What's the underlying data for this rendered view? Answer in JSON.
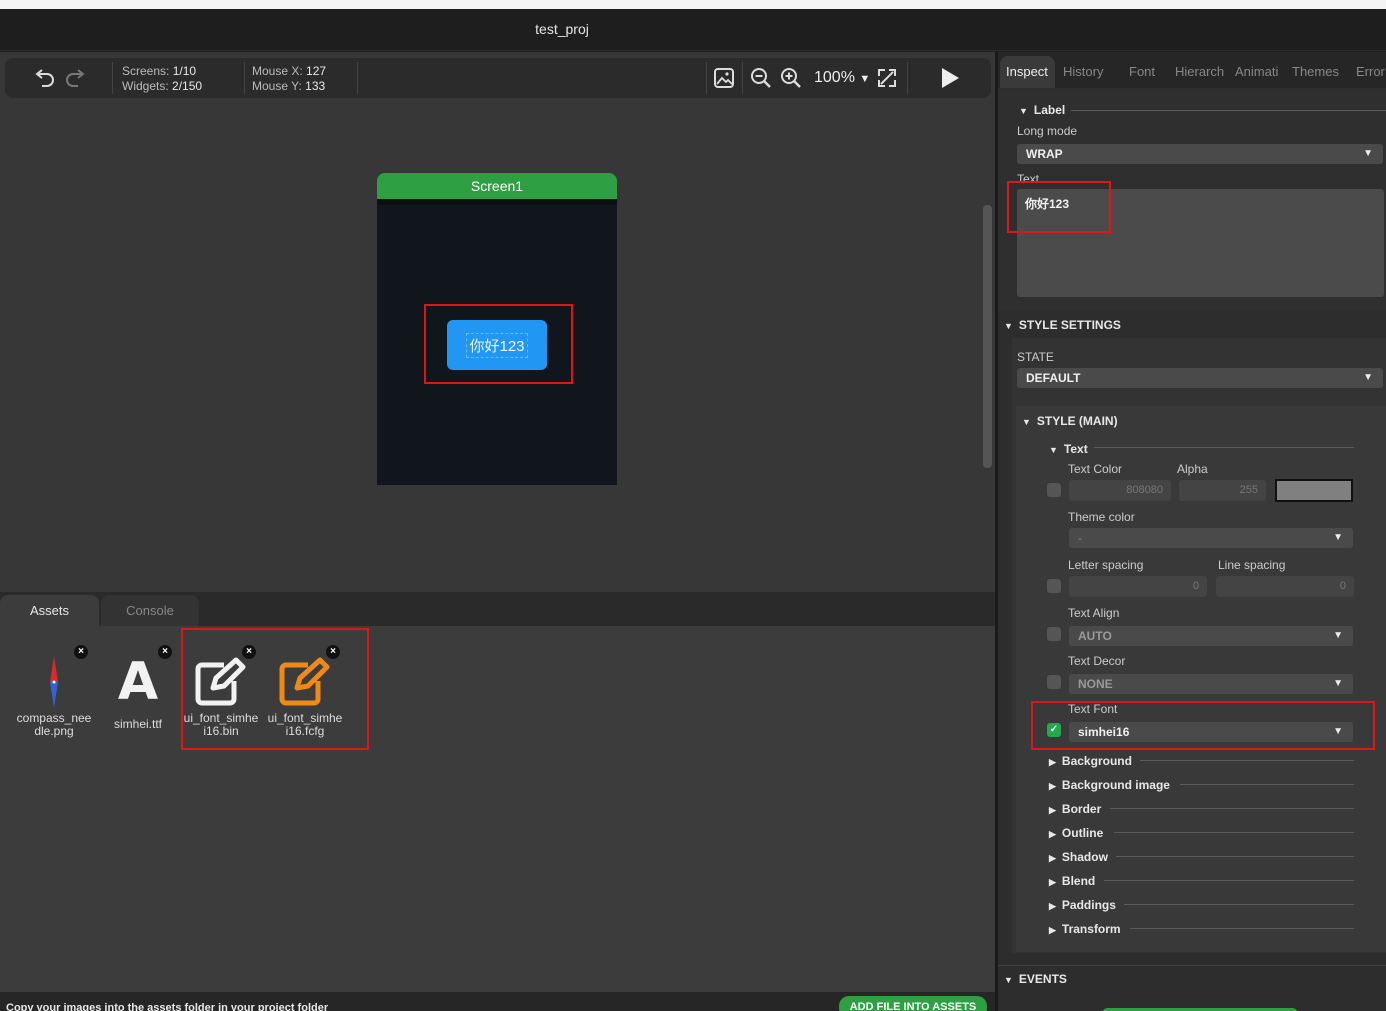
{
  "window": {
    "title": "test_proj"
  },
  "toolbar": {
    "screens_label": "Screens:",
    "screens_value": "1/10",
    "widgets_label": "Widgets:",
    "widgets_value": "2/150",
    "mouse_x_label": "Mouse X:",
    "mouse_x_value": "127",
    "mouse_y_label": "Mouse Y:",
    "mouse_y_value": "133",
    "zoom": "100%"
  },
  "canvas": {
    "screen_name": "Screen1",
    "button_text": "你好123"
  },
  "bottom_tabs": [
    {
      "label": "Assets"
    },
    {
      "label": "Console"
    }
  ],
  "assets": [
    {
      "name": "compass_nee dle.png",
      "icon": "image-icon"
    },
    {
      "name": "simhei.ttf",
      "icon": "font-icon"
    },
    {
      "name": "ui_font_simhe i16.bin",
      "icon": "edit-icon"
    },
    {
      "name": "ui_font_simhe i16.fcfg",
      "icon": "edit-icon"
    }
  ],
  "status": {
    "hint": "Copy your images into the assets folder in your project folder",
    "add_button": "ADD FILE INTO ASSETS"
  },
  "right_tabs": [
    {
      "label": "Inspect"
    },
    {
      "label": "History"
    },
    {
      "label": "Font"
    },
    {
      "label": "Hierarch"
    },
    {
      "label": "Animati"
    },
    {
      "label": "Themes"
    },
    {
      "label": "Error"
    }
  ],
  "inspector": {
    "label_section": "Label",
    "long_mode_label": "Long mode",
    "long_mode_value": "WRAP",
    "text_label": "Text",
    "text_value": "你好123",
    "style_settings": "STYLE SETTINGS",
    "state_label": "STATE",
    "state_value": "DEFAULT",
    "style_main": "STYLE (MAIN)",
    "text_section": "Text",
    "text_color_label": "Text Color",
    "alpha_label": "Alpha",
    "text_color_value": "808080",
    "alpha_value": "255",
    "swatch_color": "#808080",
    "theme_color_label": "Theme color",
    "theme_color_value": "-",
    "letter_spacing_label": "Letter spacing",
    "letter_spacing_value": "0",
    "line_spacing_label": "Line spacing",
    "line_spacing_value": "0",
    "text_align_label": "Text Align",
    "text_align_value": "AUTO",
    "text_decor_label": "Text Decor",
    "text_decor_value": "NONE",
    "text_font_label": "Text Font",
    "text_font_value": "simhei16",
    "collapsed": [
      "Background",
      "Background image",
      "Border",
      "Outline",
      "Shadow",
      "Blend",
      "Paddings",
      "Transform"
    ],
    "events": "EVENTS"
  },
  "colors": {
    "accent_green": "#2ea043",
    "highlight_red": "#e01515",
    "button_blue": "#2196f3"
  }
}
